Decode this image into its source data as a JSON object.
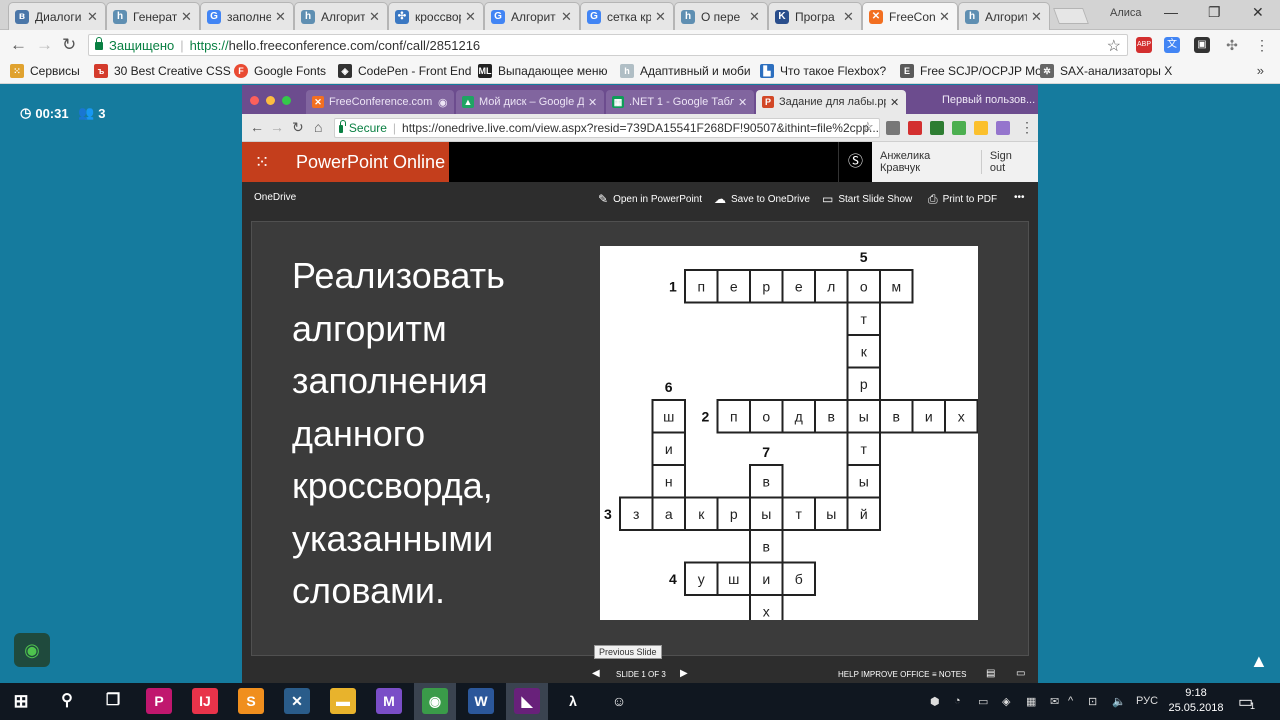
{
  "outer_browser": {
    "tabs": [
      {
        "label": "Диалоги",
        "icon": "vk-icon",
        "color": "#4a76a8"
      },
      {
        "label": "Генерат",
        "icon": "habr-icon",
        "color": "#5f8fb2"
      },
      {
        "label": "заполне",
        "icon": "google-icon",
        "color": "#4285f4"
      },
      {
        "label": "Алгорит",
        "icon": "habr-icon",
        "color": "#5f8fb2"
      },
      {
        "label": "кроссвор",
        "icon": "puzzle-icon",
        "color": "#3b78c2"
      },
      {
        "label": "Алгорит",
        "icon": "google-icon",
        "color": "#4285f4"
      },
      {
        "label": "сетка кр",
        "icon": "google-icon",
        "color": "#4285f4"
      },
      {
        "label": "О пере",
        "icon": "habr-icon",
        "color": "#5f8fb2"
      },
      {
        "label": "Програ",
        "icon": "k-icon",
        "color": "#2a4e8c"
      },
      {
        "label": "FreeCon",
        "icon": "freeconference-icon",
        "color": "#f26f21"
      },
      {
        "label": "Алгорит",
        "icon": "habr-icon",
        "color": "#5f8fb2"
      }
    ],
    "user_name": "Алиса",
    "url_secure_label": "Защищено",
    "url_scheme": "https://",
    "url_rest": "hello.freeconference.com/conf/call/2851216",
    "bookmarks": [
      {
        "label": "Сервисы",
        "icon": "apps-icon",
        "color": "#e0a22f"
      },
      {
        "label": "30 Best Creative CSS",
        "icon": "bookmark-icon",
        "color": "#d43b2c"
      },
      {
        "label": "Google Fonts",
        "icon": "fonts-icon",
        "color": "#e94a32"
      },
      {
        "label": "CodePen - Front End",
        "icon": "codepen-icon",
        "color": "#333333"
      },
      {
        "label": "Выпадающее меню",
        "icon": "ml-icon",
        "color": "#222222"
      },
      {
        "label": "Адаптивный и моби",
        "icon": "habr-icon",
        "color": "#b0bec5"
      },
      {
        "label": "Что такое Flexbox?",
        "icon": "bookmark-icon",
        "color": "#2c6fbf"
      },
      {
        "label": "Free SCJP/OCPJP Mo",
        "icon": "bookmark-icon",
        "color": "#5a5a5a"
      },
      {
        "label": "SAX-анализаторы X",
        "icon": "gear-icon",
        "color": "#666666"
      }
    ],
    "extension_badges": [
      "1",
      "2"
    ]
  },
  "conference": {
    "timer": "00:31",
    "participants": "3"
  },
  "inner_browser": {
    "tabs": [
      {
        "label": "FreeConference.com",
        "icon": "freeconference-icon",
        "color": "#f26f21"
      },
      {
        "label": "Мой диск – Google Диск",
        "icon": "drive-icon",
        "color": "#1fa463"
      },
      {
        "label": ".NET 1 - Google Таблицы",
        "icon": "sheets-icon",
        "color": "#0f9d58"
      },
      {
        "label": "Задание для лабы.pptx",
        "icon": "powerpoint-icon",
        "color": "#d24726"
      }
    ],
    "last_tab": "Первый пользов...",
    "secure_label": "Secure",
    "url": "https://onedrive.live.com/view.aspx?resid=739DA15541F268DF!90507&ithint=file%2cpp..."
  },
  "ppt": {
    "app_name": "PowerPoint Online",
    "user_name": "Анжелика Кравчук",
    "sign_out": "Sign out",
    "breadcrumb": "OneDrive",
    "commands": {
      "open": "Open in PowerPoint",
      "save": "Save to OneDrive",
      "show": "Start Slide Show",
      "print": "Print to PDF",
      "more": "•••"
    },
    "slide_text": [
      "Реализовать",
      "алгоритм",
      "заполнения",
      "данного",
      "кроссворда,",
      "указанными",
      "словами."
    ],
    "crossword": {
      "numbers": [
        "1",
        "2",
        "3",
        "4",
        "5",
        "6",
        "7"
      ],
      "words": {
        "1": "перелом",
        "2": "подвывих",
        "3": "закрытый",
        "4": "ушиб",
        "5": "открытый",
        "6": "шина",
        "7": "вывих"
      }
    },
    "tooltip": "Previous Slide",
    "slide_indicator": "SLIDE 1 OF 3",
    "help": "HELP IMPROVE OFFICE",
    "notes": "NOTES"
  },
  "taskbar": {
    "apps": [
      {
        "name": "phpstorm-icon",
        "label": "P",
        "color": "#c0176e"
      },
      {
        "name": "intellij-icon",
        "label": "IJ",
        "color": "#e8334a"
      },
      {
        "name": "sublime-icon",
        "label": "S",
        "color": "#f08f1e"
      },
      {
        "name": "network-icon",
        "label": "✕",
        "color": "#2a5c8a"
      },
      {
        "name": "explorer-icon",
        "label": "▬",
        "color": "#e8b32c"
      },
      {
        "name": "malwarebytes-icon",
        "label": "M",
        "color": "#7a4ec7"
      },
      {
        "name": "chrome-icon",
        "label": "◉",
        "color": "#3a9b49"
      },
      {
        "name": "word-icon",
        "label": "W",
        "color": "#2b579a"
      },
      {
        "name": "visualstudio-icon",
        "label": "◣",
        "color": "#68217a"
      },
      {
        "name": "lambda-icon",
        "label": "λ",
        "color": "#101720"
      },
      {
        "name": "discord-icon",
        "label": "☺",
        "color": "#101720"
      }
    ],
    "language": "РУС",
    "time": "9:18",
    "date": "25.05.2018",
    "notification_count": "1"
  }
}
